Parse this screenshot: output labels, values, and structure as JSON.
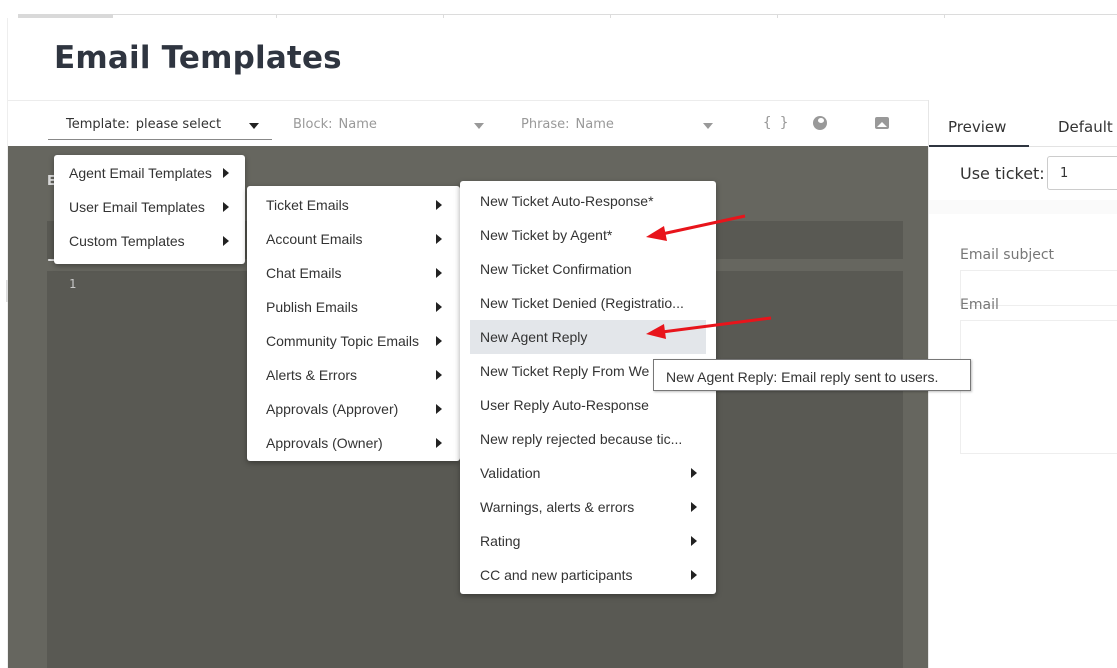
{
  "page": {
    "title": "Email Templates"
  },
  "toolbar": {
    "template_label": "Template:",
    "template_value": "please select",
    "block_label": "Block:",
    "block_value": "Name",
    "phrase_label": "Phrase:",
    "phrase_value": "Name",
    "icons": [
      "braces-icon",
      "globe-icon",
      "image-icon"
    ],
    "braces_glyph": "{ }"
  },
  "right_panel": {
    "tabs": [
      "Preview",
      "Default"
    ],
    "use_ticket_label": "Use ticket:",
    "use_ticket_value": "1",
    "email_subject_label": "Email subject",
    "email_label": "Email"
  },
  "editor": {
    "line_number": "1",
    "label_e1": "E",
    "label_e2": "E"
  },
  "menu_level1": {
    "items": [
      {
        "label": "Agent Email Templates",
        "submenu": true
      },
      {
        "label": "User Email Templates",
        "submenu": true
      },
      {
        "label": "Custom Templates",
        "submenu": true
      }
    ]
  },
  "menu_level2": {
    "items": [
      {
        "label": "Ticket Emails"
      },
      {
        "label": "Account Emails"
      },
      {
        "label": "Chat Emails"
      },
      {
        "label": "Publish Emails"
      },
      {
        "label": "Community Topic Emails"
      },
      {
        "label": "Alerts & Errors"
      },
      {
        "label": "Approvals (Approver)"
      },
      {
        "label": "Approvals (Owner)"
      }
    ]
  },
  "menu_level3": {
    "items": [
      {
        "label": "New Ticket Auto-Response*",
        "submenu": false
      },
      {
        "label": "New Ticket by Agent*",
        "submenu": false
      },
      {
        "label": "New Ticket Confirmation",
        "submenu": false
      },
      {
        "label": "New Ticket Denied (Registratio...",
        "submenu": false
      },
      {
        "label": "New Agent Reply",
        "submenu": false,
        "highlighted": true
      },
      {
        "label": "New Ticket Reply From We",
        "submenu": false
      },
      {
        "label": "User Reply Auto-Response",
        "submenu": false
      },
      {
        "label": "New reply rejected because tic...",
        "submenu": false
      },
      {
        "label": "Validation",
        "submenu": true
      },
      {
        "label": "Warnings, alerts & errors",
        "submenu": true
      },
      {
        "label": "Rating",
        "submenu": true
      },
      {
        "label": "CC and new participants",
        "submenu": true
      }
    ]
  },
  "tooltip": {
    "text": "New Agent Reply: Email reply sent to users."
  },
  "colors": {
    "editor_bg": "#66665f",
    "annotation_arrow": "#e8141b",
    "highlight": "#e3e6ea"
  }
}
